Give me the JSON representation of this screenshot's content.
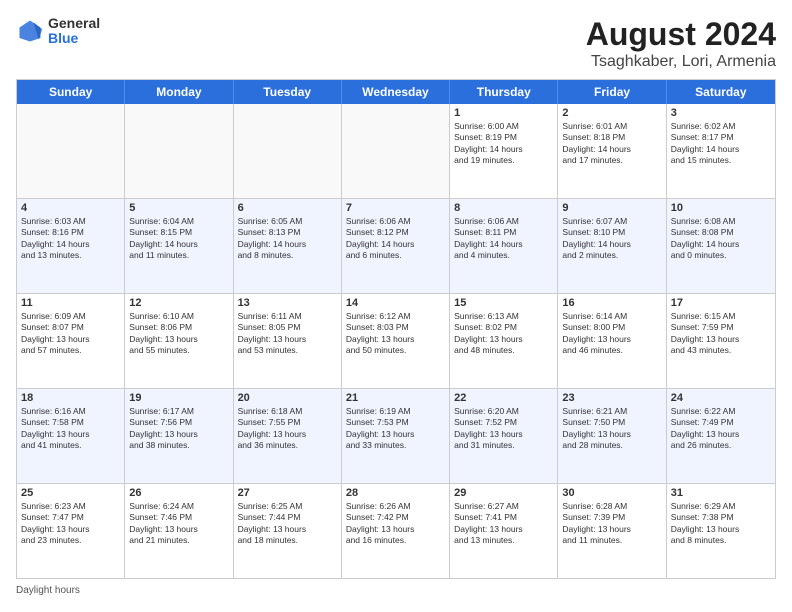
{
  "header": {
    "logo_line1": "General",
    "logo_line2": "Blue",
    "main_title": "August 2024",
    "subtitle": "Tsaghkaber, Lori, Armenia"
  },
  "day_headers": [
    "Sunday",
    "Monday",
    "Tuesday",
    "Wednesday",
    "Thursday",
    "Friday",
    "Saturday"
  ],
  "weeks": [
    {
      "alt": false,
      "days": [
        {
          "num": "",
          "info": ""
        },
        {
          "num": "",
          "info": ""
        },
        {
          "num": "",
          "info": ""
        },
        {
          "num": "",
          "info": ""
        },
        {
          "num": "1",
          "info": "Sunrise: 6:00 AM\nSunset: 8:19 PM\nDaylight: 14 hours\nand 19 minutes."
        },
        {
          "num": "2",
          "info": "Sunrise: 6:01 AM\nSunset: 8:18 PM\nDaylight: 14 hours\nand 17 minutes."
        },
        {
          "num": "3",
          "info": "Sunrise: 6:02 AM\nSunset: 8:17 PM\nDaylight: 14 hours\nand 15 minutes."
        }
      ]
    },
    {
      "alt": true,
      "days": [
        {
          "num": "4",
          "info": "Sunrise: 6:03 AM\nSunset: 8:16 PM\nDaylight: 14 hours\nand 13 minutes."
        },
        {
          "num": "5",
          "info": "Sunrise: 6:04 AM\nSunset: 8:15 PM\nDaylight: 14 hours\nand 11 minutes."
        },
        {
          "num": "6",
          "info": "Sunrise: 6:05 AM\nSunset: 8:13 PM\nDaylight: 14 hours\nand 8 minutes."
        },
        {
          "num": "7",
          "info": "Sunrise: 6:06 AM\nSunset: 8:12 PM\nDaylight: 14 hours\nand 6 minutes."
        },
        {
          "num": "8",
          "info": "Sunrise: 6:06 AM\nSunset: 8:11 PM\nDaylight: 14 hours\nand 4 minutes."
        },
        {
          "num": "9",
          "info": "Sunrise: 6:07 AM\nSunset: 8:10 PM\nDaylight: 14 hours\nand 2 minutes."
        },
        {
          "num": "10",
          "info": "Sunrise: 6:08 AM\nSunset: 8:08 PM\nDaylight: 14 hours\nand 0 minutes."
        }
      ]
    },
    {
      "alt": false,
      "days": [
        {
          "num": "11",
          "info": "Sunrise: 6:09 AM\nSunset: 8:07 PM\nDaylight: 13 hours\nand 57 minutes."
        },
        {
          "num": "12",
          "info": "Sunrise: 6:10 AM\nSunset: 8:06 PM\nDaylight: 13 hours\nand 55 minutes."
        },
        {
          "num": "13",
          "info": "Sunrise: 6:11 AM\nSunset: 8:05 PM\nDaylight: 13 hours\nand 53 minutes."
        },
        {
          "num": "14",
          "info": "Sunrise: 6:12 AM\nSunset: 8:03 PM\nDaylight: 13 hours\nand 50 minutes."
        },
        {
          "num": "15",
          "info": "Sunrise: 6:13 AM\nSunset: 8:02 PM\nDaylight: 13 hours\nand 48 minutes."
        },
        {
          "num": "16",
          "info": "Sunrise: 6:14 AM\nSunset: 8:00 PM\nDaylight: 13 hours\nand 46 minutes."
        },
        {
          "num": "17",
          "info": "Sunrise: 6:15 AM\nSunset: 7:59 PM\nDaylight: 13 hours\nand 43 minutes."
        }
      ]
    },
    {
      "alt": true,
      "days": [
        {
          "num": "18",
          "info": "Sunrise: 6:16 AM\nSunset: 7:58 PM\nDaylight: 13 hours\nand 41 minutes."
        },
        {
          "num": "19",
          "info": "Sunrise: 6:17 AM\nSunset: 7:56 PM\nDaylight: 13 hours\nand 38 minutes."
        },
        {
          "num": "20",
          "info": "Sunrise: 6:18 AM\nSunset: 7:55 PM\nDaylight: 13 hours\nand 36 minutes."
        },
        {
          "num": "21",
          "info": "Sunrise: 6:19 AM\nSunset: 7:53 PM\nDaylight: 13 hours\nand 33 minutes."
        },
        {
          "num": "22",
          "info": "Sunrise: 6:20 AM\nSunset: 7:52 PM\nDaylight: 13 hours\nand 31 minutes."
        },
        {
          "num": "23",
          "info": "Sunrise: 6:21 AM\nSunset: 7:50 PM\nDaylight: 13 hours\nand 28 minutes."
        },
        {
          "num": "24",
          "info": "Sunrise: 6:22 AM\nSunset: 7:49 PM\nDaylight: 13 hours\nand 26 minutes."
        }
      ]
    },
    {
      "alt": false,
      "days": [
        {
          "num": "25",
          "info": "Sunrise: 6:23 AM\nSunset: 7:47 PM\nDaylight: 13 hours\nand 23 minutes."
        },
        {
          "num": "26",
          "info": "Sunrise: 6:24 AM\nSunset: 7:46 PM\nDaylight: 13 hours\nand 21 minutes."
        },
        {
          "num": "27",
          "info": "Sunrise: 6:25 AM\nSunset: 7:44 PM\nDaylight: 13 hours\nand 18 minutes."
        },
        {
          "num": "28",
          "info": "Sunrise: 6:26 AM\nSunset: 7:42 PM\nDaylight: 13 hours\nand 16 minutes."
        },
        {
          "num": "29",
          "info": "Sunrise: 6:27 AM\nSunset: 7:41 PM\nDaylight: 13 hours\nand 13 minutes."
        },
        {
          "num": "30",
          "info": "Sunrise: 6:28 AM\nSunset: 7:39 PM\nDaylight: 13 hours\nand 11 minutes."
        },
        {
          "num": "31",
          "info": "Sunrise: 6:29 AM\nSunset: 7:38 PM\nDaylight: 13 hours\nand 8 minutes."
        }
      ]
    }
  ],
  "footer": {
    "note": "Daylight hours"
  },
  "colors": {
    "header_bg": "#2a6fdb",
    "alt_row_bg": "#e8eeff",
    "normal_row_bg": "#ffffff",
    "empty_bg": "#f5f5f5"
  }
}
